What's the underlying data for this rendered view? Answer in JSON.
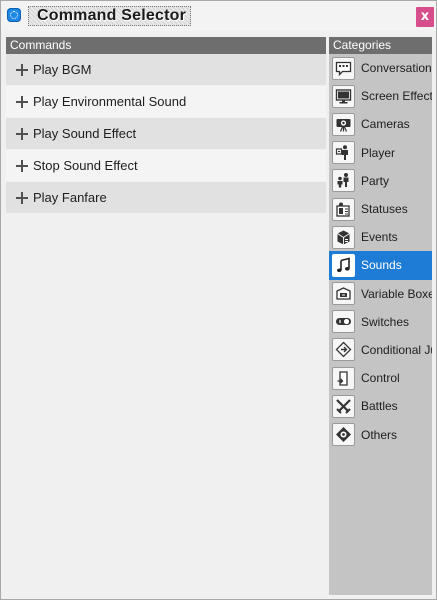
{
  "window": {
    "title": "Command Selector",
    "close_glyph": "x"
  },
  "commands": {
    "header": "Commands",
    "items": [
      {
        "label": "Play BGM",
        "icon": "plus-icon"
      },
      {
        "label": "Play Environmental Sound",
        "icon": "plus-icon"
      },
      {
        "label": "Play Sound Effect",
        "icon": "plus-icon"
      },
      {
        "label": "Stop Sound Effect",
        "icon": "plus-icon"
      },
      {
        "label": "Play Fanfare",
        "icon": "plus-icon"
      }
    ]
  },
  "categories": {
    "header": "Categories",
    "selected": "Sounds",
    "items": [
      {
        "label": "Conversation",
        "icon": "speech-bubble-icon"
      },
      {
        "label": "Screen Effects",
        "icon": "monitor-icon"
      },
      {
        "label": "Cameras",
        "icon": "camera-icon"
      },
      {
        "label": "Player",
        "icon": "player-icon"
      },
      {
        "label": "Party",
        "icon": "party-icon"
      },
      {
        "label": "Statuses",
        "icon": "statuses-icon"
      },
      {
        "label": "Events",
        "icon": "events-icon"
      },
      {
        "label": "Sounds",
        "icon": "music-note-icon"
      },
      {
        "label": "Variable Boxes",
        "icon": "variable-box-icon"
      },
      {
        "label": "Switches",
        "icon": "toggle-switch-icon"
      },
      {
        "label": "Conditional Jumps",
        "icon": "conditional-jump-icon"
      },
      {
        "label": "Control",
        "icon": "control-icon"
      },
      {
        "label": "Battles",
        "icon": "crossed-swords-icon"
      },
      {
        "label": "Others",
        "icon": "others-icon"
      }
    ]
  },
  "colors": {
    "accent": "#1e7bd6",
    "header": "#6e6e6e",
    "close": "#d64f8c"
  }
}
